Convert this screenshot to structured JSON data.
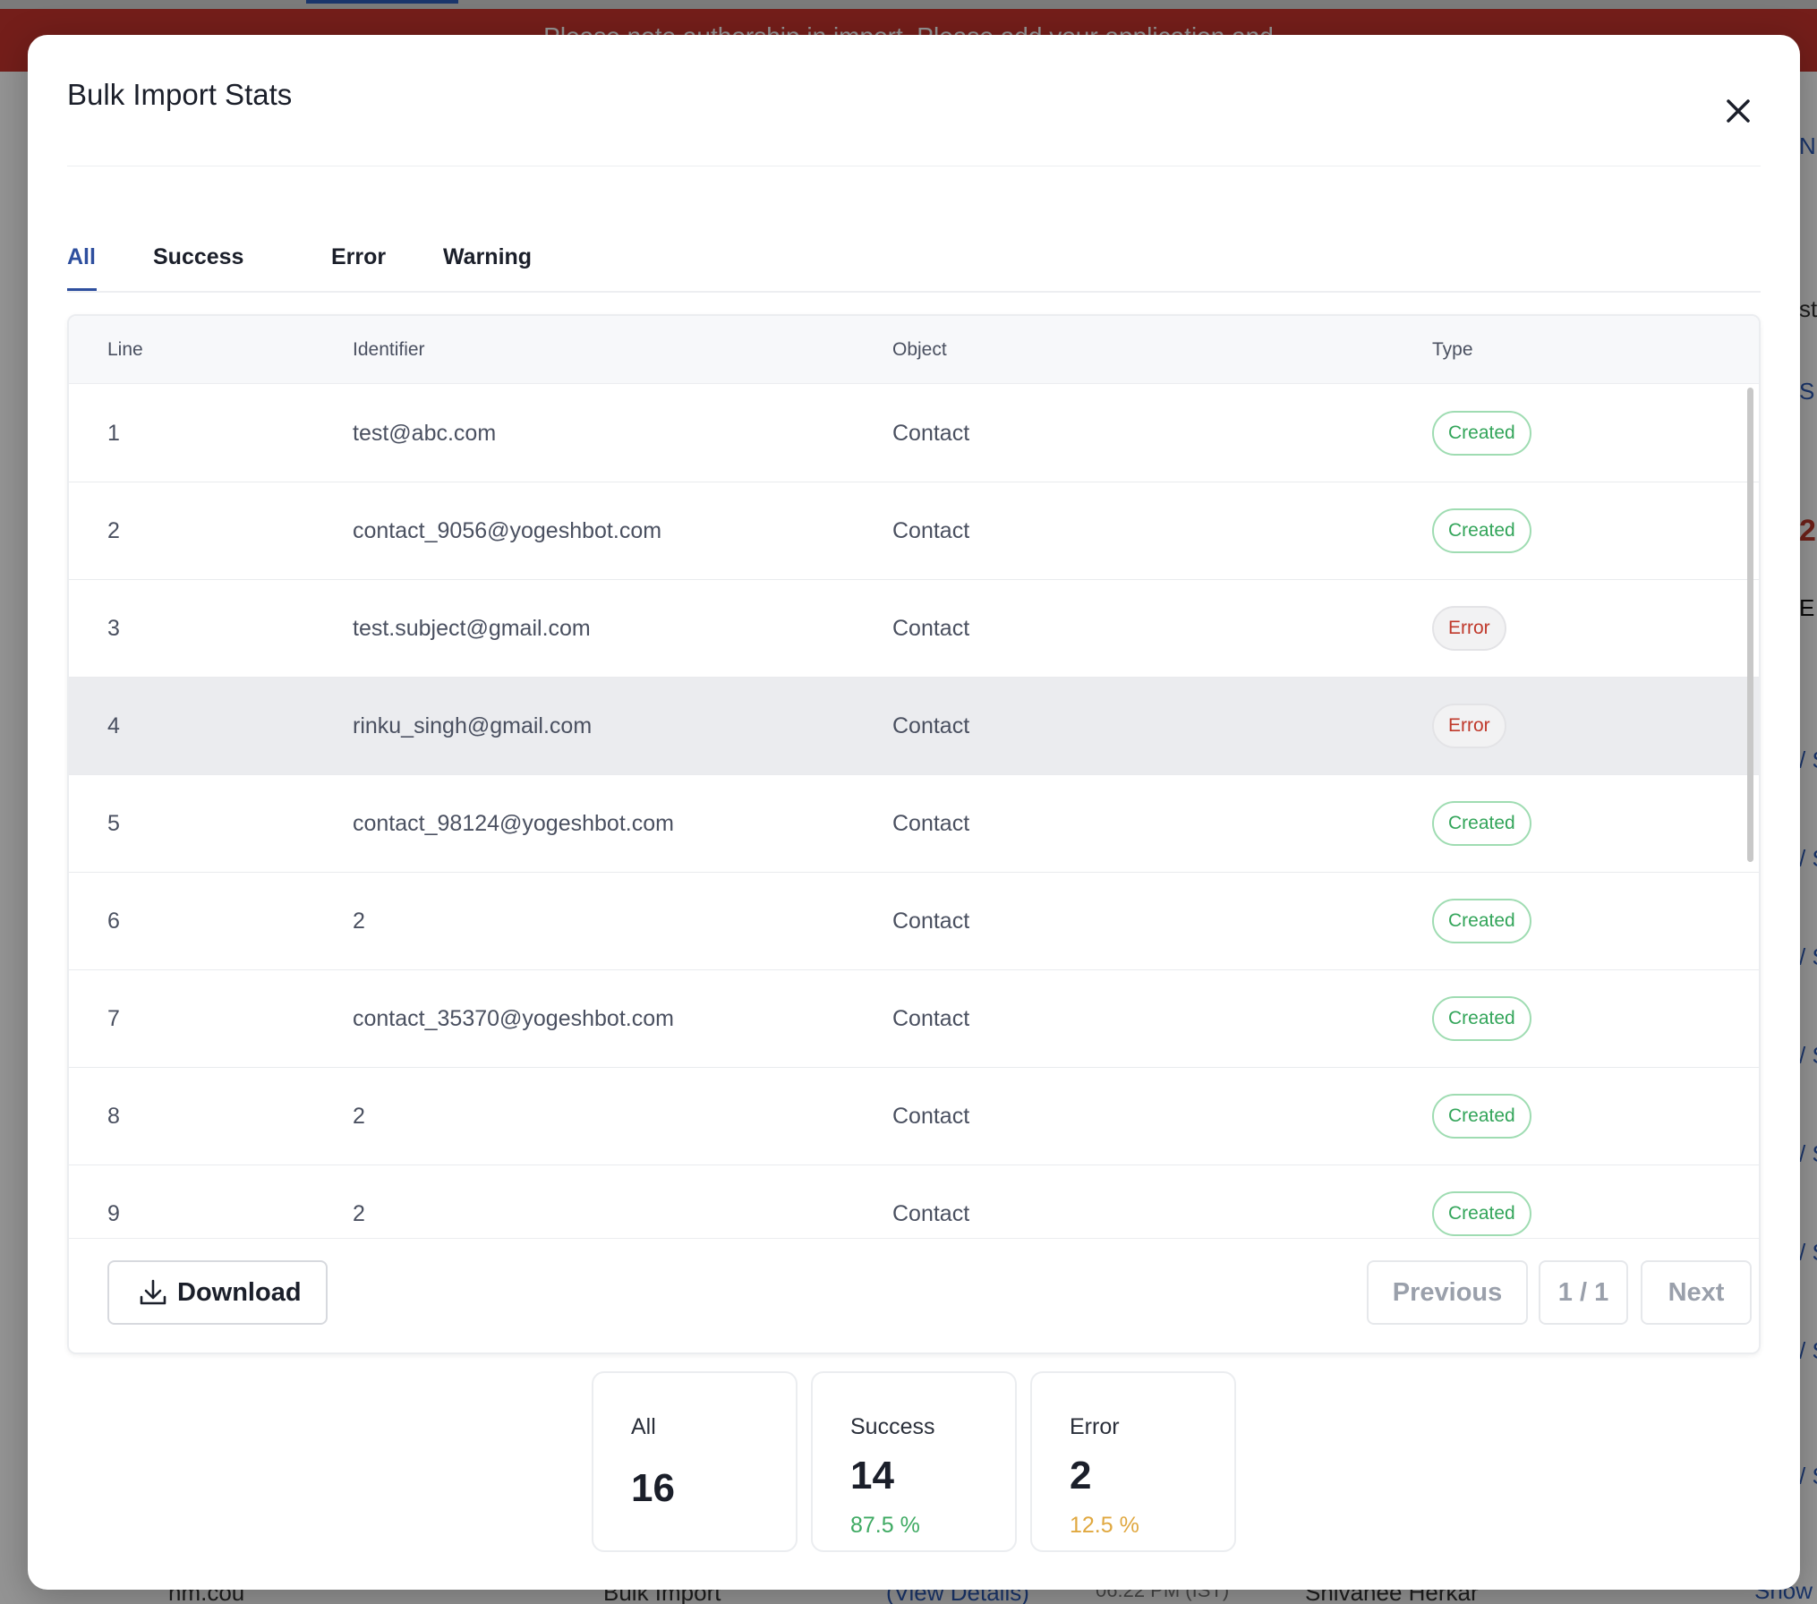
{
  "background": {
    "banner_text": "Please note authorship in import. Please add your application and",
    "right_edge_items": [
      "N",
      "sti",
      "S",
      "2",
      "E",
      "/ S",
      "/ S",
      "/ S",
      "/ S",
      "/ S",
      "/ S",
      "/ S",
      "/ S",
      "Show S"
    ],
    "bottom_items": [
      "nm.cou",
      "Bulk Import",
      "(View Details)",
      "06:22 PM (IST)",
      "Shivanee Herkar"
    ]
  },
  "modal": {
    "title": "Bulk Import Stats",
    "tabs": [
      {
        "label": "All",
        "active": true
      },
      {
        "label": "Success",
        "active": false
      },
      {
        "label": "Error",
        "active": false
      },
      {
        "label": "Warning",
        "active": false
      }
    ],
    "table": {
      "columns": [
        "Line",
        "Identifier",
        "Object",
        "Type"
      ],
      "rows": [
        {
          "line": "1",
          "identifier": "test@abc.com",
          "object": "Contact",
          "type": "Created"
        },
        {
          "line": "2",
          "identifier": "contact_9056@yogeshbot.com",
          "object": "Contact",
          "type": "Created"
        },
        {
          "line": "3",
          "identifier": "test.subject@gmail.com",
          "object": "Contact",
          "type": "Error"
        },
        {
          "line": "4",
          "identifier": "rinku_singh@gmail.com",
          "object": "Contact",
          "type": "Error"
        },
        {
          "line": "5",
          "identifier": "contact_98124@yogeshbot.com",
          "object": "Contact",
          "type": "Created"
        },
        {
          "line": "6",
          "identifier": "2",
          "object": "Contact",
          "type": "Created"
        },
        {
          "line": "7",
          "identifier": "contact_35370@yogeshbot.com",
          "object": "Contact",
          "type": "Created"
        },
        {
          "line": "8",
          "identifier": "2",
          "object": "Contact",
          "type": "Created"
        },
        {
          "line": "9",
          "identifier": "2",
          "object": "Contact",
          "type": "Created"
        }
      ]
    },
    "footer": {
      "download_label": "Download",
      "previous_label": "Previous",
      "page_indicator": "1 / 1",
      "next_label": "Next"
    },
    "stats": [
      {
        "label": "All",
        "value": "16",
        "percent": ""
      },
      {
        "label": "Success",
        "value": "14",
        "percent": "87.5 %"
      },
      {
        "label": "Error",
        "value": "2",
        "percent": "12.5 %"
      }
    ]
  },
  "colors": {
    "accent": "#2e4f9e",
    "created": "#33a55a",
    "error": "#c0392b",
    "success_pct": "#3faa63",
    "error_pct": "#e0a840",
    "banner": "#c8342e"
  }
}
